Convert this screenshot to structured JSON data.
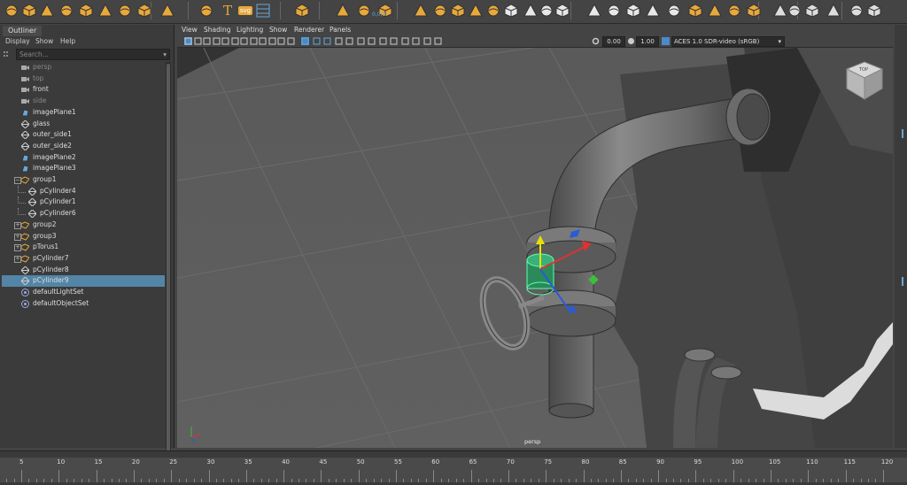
{
  "shelf": {
    "icons": [
      "sphere-icon",
      "cube-icon",
      "cylinder-icon",
      "cone-icon",
      "torus-icon",
      "plane-icon",
      "disc-icon",
      "platonic-icon",
      "sweep-icon",
      "curve-icon",
      "text-icon",
      "svg-icon",
      "uv-editor-icon",
      "measure-icon",
      "snap-together-icon",
      "reset-icon",
      "combine-icon",
      "separate-icon",
      "extract-icon",
      "boolean-icon",
      "smooth-icon",
      "mirror-icon",
      "bridge-icon",
      "extrude-icon",
      "bevel-icon",
      "append-icon",
      "fill-hole-icon",
      "multi-cut-icon",
      "target-weld-icon",
      "connect-icon",
      "quad-draw-icon",
      "edge-loop-icon",
      "knife-icon",
      "wedge-icon",
      "poke-icon",
      "chamfer-icon",
      "collapse-icon",
      "crease-icon",
      "bend-icon",
      "lattice-icon",
      "cluster-icon"
    ],
    "svg_label": "svg",
    "coord_label": "0,0,0"
  },
  "outliner": {
    "tab": "Outliner",
    "menu": [
      "Display",
      "Show",
      "Help"
    ],
    "search_placeholder": "Search...",
    "items": [
      {
        "label": "persp",
        "icon": "camera-icon",
        "indent": 0,
        "dim": true,
        "expand": ""
      },
      {
        "label": "top",
        "icon": "camera-icon",
        "indent": 0,
        "dim": true,
        "expand": ""
      },
      {
        "label": "front",
        "icon": "camera-icon",
        "indent": 0,
        "dim": false,
        "expand": ""
      },
      {
        "label": "side",
        "icon": "camera-icon",
        "indent": 0,
        "dim": true,
        "expand": ""
      },
      {
        "label": "imagePlane1",
        "icon": "image-plane-icon",
        "indent": 0,
        "dim": false,
        "expand": ""
      },
      {
        "label": "glass",
        "icon": "mesh-icon",
        "indent": 0,
        "dim": false,
        "expand": ""
      },
      {
        "label": "outer_side1",
        "icon": "mesh-icon",
        "indent": 0,
        "dim": false,
        "expand": ""
      },
      {
        "label": "outer_side2",
        "icon": "mesh-icon",
        "indent": 0,
        "dim": false,
        "expand": ""
      },
      {
        "label": "imagePlane2",
        "icon": "image-plane-icon",
        "indent": 0,
        "dim": false,
        "expand": ""
      },
      {
        "label": "imagePlane3",
        "icon": "image-plane-icon",
        "indent": 0,
        "dim": false,
        "expand": ""
      },
      {
        "label": "group1",
        "icon": "group-icon",
        "indent": 0,
        "dim": false,
        "expand": "−"
      },
      {
        "label": "pCylinder4",
        "icon": "mesh-icon",
        "indent": 1,
        "dim": false,
        "expand": ""
      },
      {
        "label": "pCylinder1",
        "icon": "mesh-icon",
        "indent": 1,
        "dim": false,
        "expand": ""
      },
      {
        "label": "pCylinder6",
        "icon": "mesh-icon",
        "indent": 1,
        "dim": false,
        "expand": ""
      },
      {
        "label": "group2",
        "icon": "group-icon",
        "indent": 0,
        "dim": false,
        "expand": "+"
      },
      {
        "label": "group3",
        "icon": "group-icon",
        "indent": 0,
        "dim": false,
        "expand": "+"
      },
      {
        "label": "pTorus1",
        "icon": "group-icon",
        "indent": 0,
        "dim": false,
        "expand": "+"
      },
      {
        "label": "pCylinder7",
        "icon": "group-icon",
        "indent": 0,
        "dim": false,
        "expand": "+"
      },
      {
        "label": "pCylinder8",
        "icon": "mesh-icon",
        "indent": 0,
        "dim": false,
        "expand": ""
      },
      {
        "label": "pCylinder9",
        "icon": "mesh-icon",
        "indent": 0,
        "dim": false,
        "expand": "",
        "selected": true
      },
      {
        "label": "defaultLightSet",
        "icon": "set-icon",
        "indent": 0,
        "dim": false,
        "expand": ""
      },
      {
        "label": "defaultObjectSet",
        "icon": "set-icon",
        "indent": 0,
        "dim": false,
        "expand": ""
      }
    ]
  },
  "viewport": {
    "menu": [
      "View",
      "Shading",
      "Lighting",
      "Show",
      "Renderer",
      "Panels"
    ],
    "exposure": "0.00",
    "gamma": "1.00",
    "color_space": "ACES 1.0 SDR-video (sRGB)",
    "camera_label": "persp",
    "viewcube_label": "TOP"
  },
  "timeline": {
    "ticks": [
      "5",
      "10",
      "15",
      "20",
      "25",
      "30",
      "35",
      "40",
      "45",
      "50",
      "55",
      "60",
      "65",
      "70",
      "75",
      "80",
      "85",
      "90",
      "95",
      "100",
      "105",
      "110",
      "115",
      "120"
    ]
  },
  "colors": {
    "accent": "#e8a83a",
    "selection": "#5285a6",
    "background": "#444444"
  }
}
